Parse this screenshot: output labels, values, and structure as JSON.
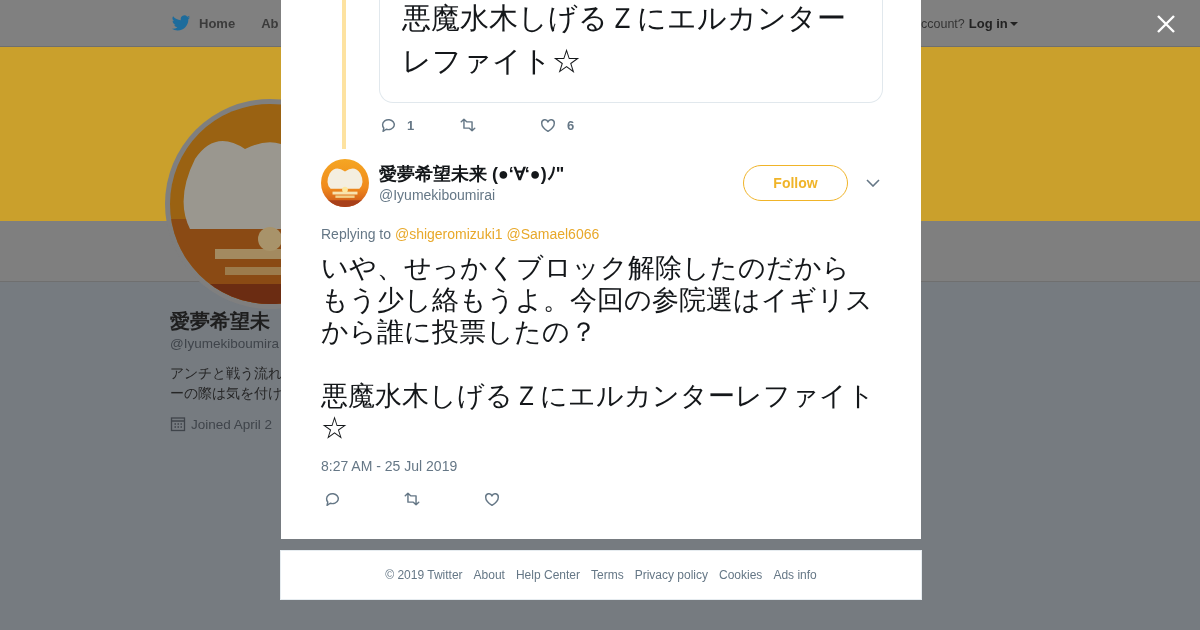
{
  "background_page": {
    "nav_items": [
      "Home",
      "Ab"
    ],
    "login_prompt": "ccount?",
    "login_link": "Log in",
    "profile": {
      "name": "愛夢希望未",
      "handle": "@Iyumekiboumira",
      "bio": [
        "アンチと戦う流れ",
        "ーの際は気を付け"
      ],
      "joined": "Joined April 2"
    }
  },
  "modal": {
    "quoted_tweet": {
      "text": "悪魔水木しげるＺにエルカンターレファイト☆",
      "actions": [
        {
          "kind": "reply",
          "count": "1"
        },
        {
          "kind": "retweet"
        },
        {
          "kind": "like",
          "count": "6"
        }
      ]
    },
    "tweet": {
      "name": "愛夢希望未来 (●‘∀‘●)ﾉ\"",
      "handle": "@Iyumekiboumirai",
      "follow_button": "Follow",
      "replying_label": "Replying to",
      "replying_to": [
        "@shigeromizuki1",
        "@Samael6066"
      ],
      "text_paragraphs": [
        "いや、せっかくブロック解除したのだからもう少し絡もうよ。今回の参院選はイギリスから誰に投票したの？",
        "悪魔水木しげるＺにエルカンターレファイト☆"
      ],
      "timestamp": "8:27 AM - 25 Jul 2019",
      "actions": [
        {
          "kind": "reply"
        },
        {
          "kind": "retweet"
        },
        {
          "kind": "like"
        }
      ]
    }
  },
  "footer": {
    "copyright": "© 2019 Twitter",
    "links": [
      "About",
      "Help Center",
      "Terms",
      "Privacy policy",
      "Cookies",
      "Ads info"
    ]
  }
}
